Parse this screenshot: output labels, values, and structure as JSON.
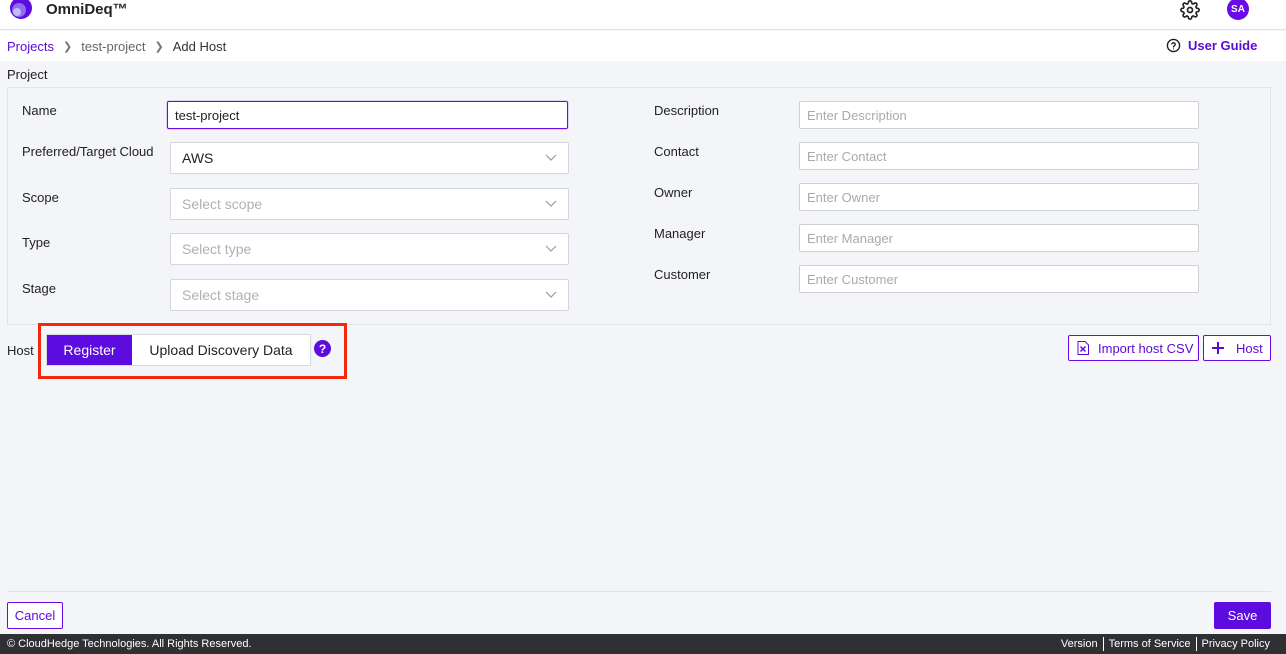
{
  "app": {
    "name": "OmniDeq™",
    "user_initials": "SA"
  },
  "breadcrumb": {
    "root": "Projects",
    "project": "test-project",
    "current": "Add Host"
  },
  "header": {
    "user_guide": "User Guide"
  },
  "project": {
    "section_title": "Project",
    "name_label": "Name",
    "name_value": "test-project",
    "cloud_label": "Preferred/Target Cloud",
    "cloud_value": "AWS",
    "scope_label": "Scope",
    "scope_placeholder": "Select scope",
    "type_label": "Type",
    "type_placeholder": "Select type",
    "stage_label": "Stage",
    "stage_placeholder": "Select stage",
    "description_label": "Description",
    "description_placeholder": "Enter Description",
    "contact_label": "Contact",
    "contact_placeholder": "Enter Contact",
    "owner_label": "Owner",
    "owner_placeholder": "Enter Owner",
    "manager_label": "Manager",
    "manager_placeholder": "Enter Manager",
    "customer_label": "Customer",
    "customer_placeholder": "Enter Customer"
  },
  "host": {
    "label": "Host",
    "tab_register": "Register",
    "tab_upload": "Upload Discovery Data",
    "help": "?",
    "import_csv": "Import host CSV",
    "add_host": "Host"
  },
  "actions": {
    "cancel": "Cancel",
    "save": "Save"
  },
  "footer": {
    "copyright": "© CloudHedge Technologies. All Rights Reserved.",
    "version": "Version",
    "terms": "Terms of Service",
    "privacy": "Privacy Policy"
  },
  "colors": {
    "accent": "#5d0ce0",
    "highlight": "#f0290f",
    "footer_bg": "#2f3034"
  }
}
